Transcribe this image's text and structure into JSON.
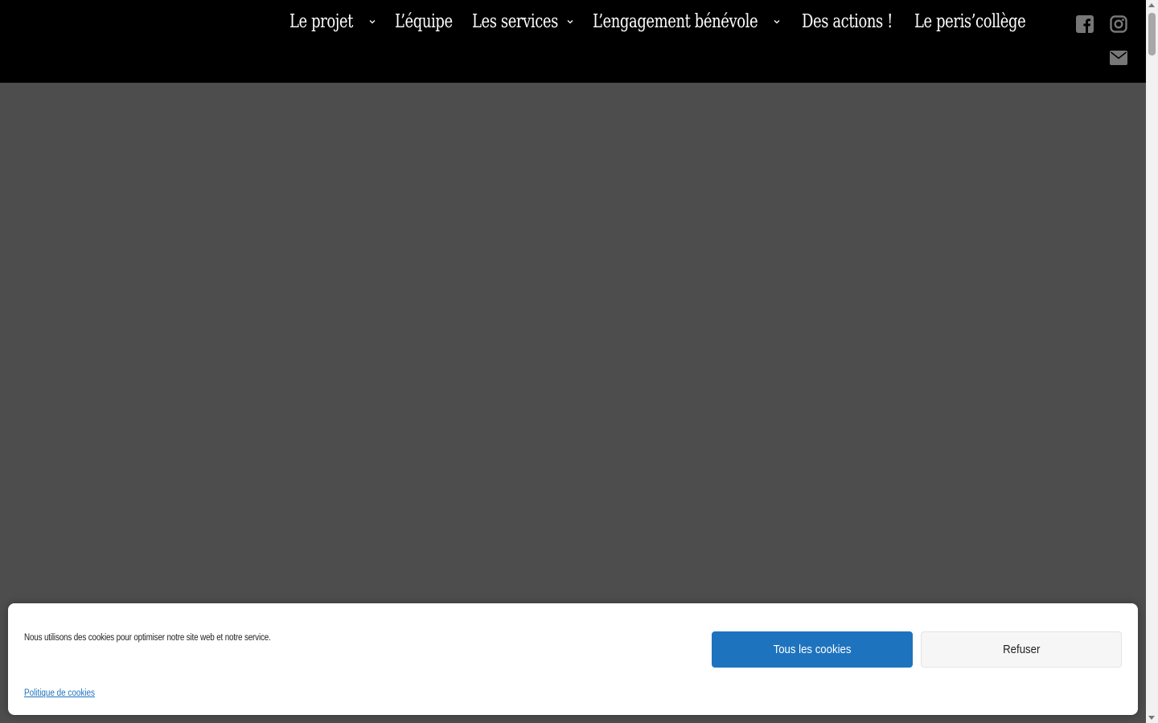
{
  "nav": {
    "items": [
      {
        "label": "Le projet",
        "has_submenu": true
      },
      {
        "label": "L’équipe",
        "has_submenu": false
      },
      {
        "label": "Les services",
        "has_submenu": true
      },
      {
        "label": "L’engagement bénévole",
        "has_submenu": true
      },
      {
        "label": "Des actions !",
        "has_submenu": false
      },
      {
        "label": "Le peris’collège",
        "has_submenu": false
      }
    ]
  },
  "social": {
    "icons": [
      "facebook-icon",
      "instagram-icon",
      "mail-icon"
    ],
    "color": "#777777"
  },
  "colors": {
    "header_bg": "#000000",
    "page_bg": "#4d4d4d",
    "accent": "#1e73be"
  },
  "cookie": {
    "message": "Nous utilisons des cookies pour optimiser notre site web et notre service.",
    "policy_link": "Politique de cookies",
    "accept_label": "Tous les cookies",
    "deny_label": "Refuser"
  }
}
